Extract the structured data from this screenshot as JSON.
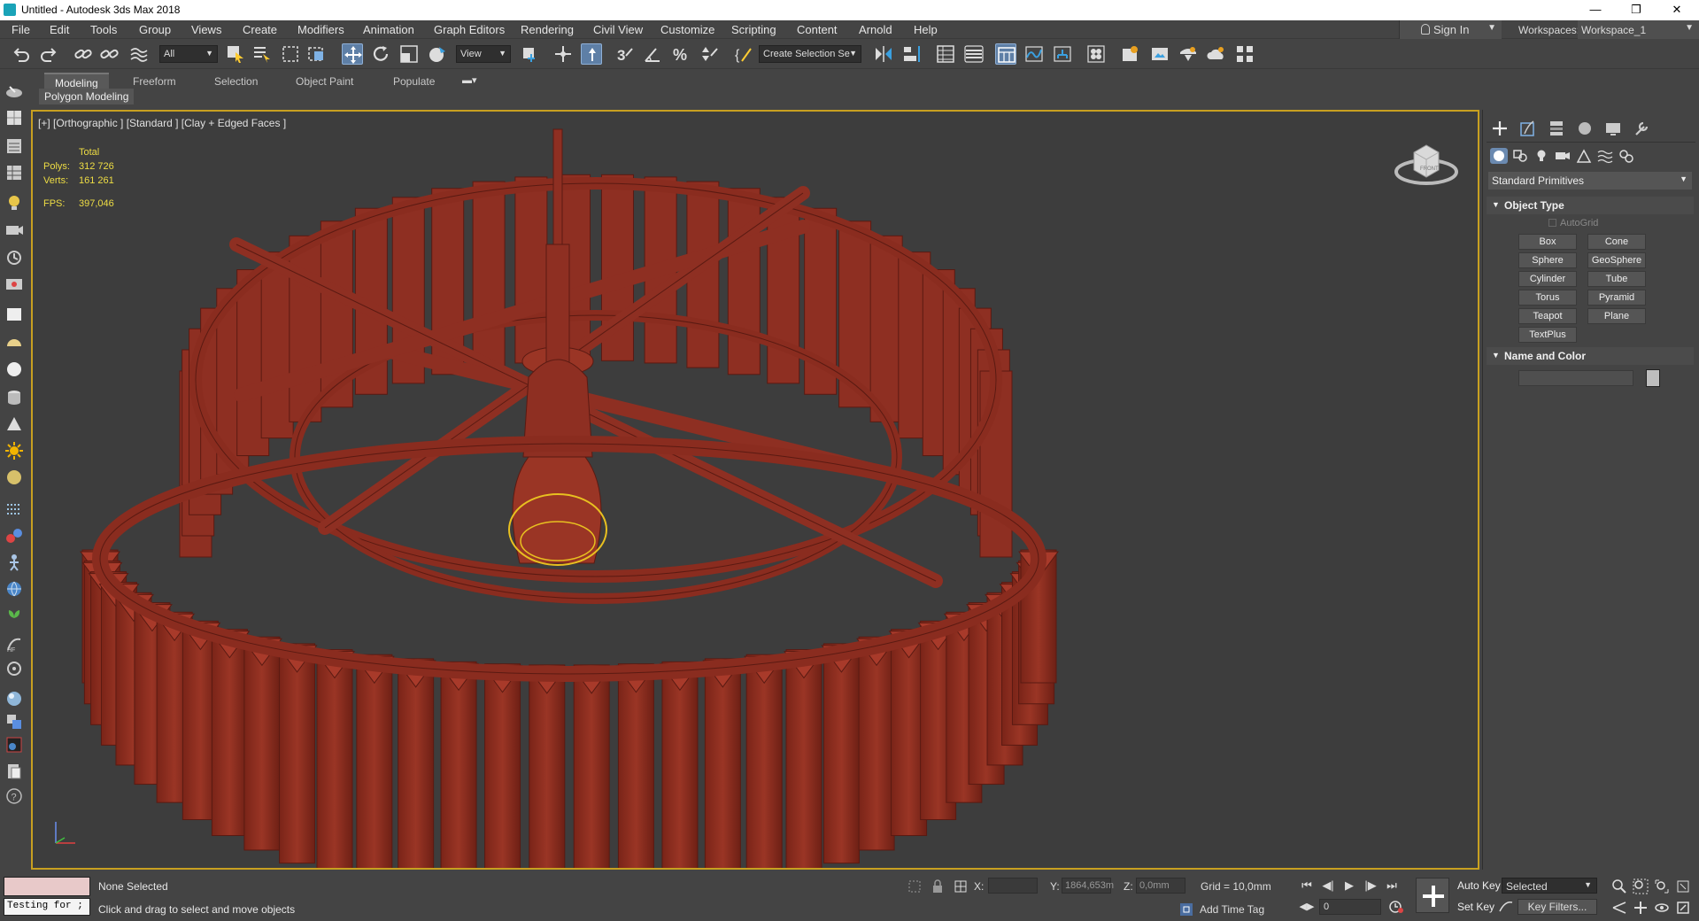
{
  "window": {
    "title": "Untitled - Autodesk 3ds Max 2018",
    "controls": {
      "minimize": "—",
      "restore": "❐",
      "close": "✕"
    }
  },
  "menu": [
    "File",
    "Edit",
    "Tools",
    "Group",
    "Views",
    "Create",
    "Modifiers",
    "Animation",
    "Graph Editors",
    "Rendering",
    "Civil View",
    "Customize",
    "Scripting",
    "Content",
    "Arnold",
    "Help"
  ],
  "account": {
    "sign_in": "Sign In",
    "workspaces_label": "Workspaces:",
    "workspace": "Workspace_1"
  },
  "toolbar": {
    "selection_filter": "All",
    "ref_coord": "View",
    "selection_set": "Create Selection Se"
  },
  "ribbon": {
    "tabs": [
      "Modeling",
      "Freeform",
      "Selection",
      "Object Paint",
      "Populate"
    ],
    "active_tab": "Modeling",
    "panel_label": "Polygon Modeling"
  },
  "viewport": {
    "label": "[+] [Orthographic ] [Standard ] [Clay + Edged Faces ]",
    "stats": {
      "header": "Total",
      "polys_label": "Polys:",
      "polys": "312 726",
      "verts_label": "Verts:",
      "verts": "161 261",
      "fps_label": "FPS:",
      "fps": "397,046"
    },
    "viewcube_face": "FRONT",
    "model_color": "#8e2f22",
    "wire_color": "#5a1a12",
    "selection_color": "#e8c020"
  },
  "command_panel": {
    "category": "Standard Primitives",
    "object_type": {
      "title": "Object Type",
      "autogrid": "AutoGrid",
      "buttons": [
        "Box",
        "Cone",
        "Sphere",
        "GeoSphere",
        "Cylinder",
        "Tube",
        "Torus",
        "Pyramid",
        "Teapot",
        "Plane",
        "TextPlus"
      ]
    },
    "name_and_color": {
      "title": "Name and Color"
    }
  },
  "status": {
    "maxscript_text": "Testing for ;",
    "line1": "None Selected",
    "line2": "Click and drag to select and move objects",
    "x_label": "X:",
    "y_label": "Y:",
    "y_value": "1864,653m",
    "z_label": "Z:",
    "z_value": "0,0mm",
    "grid": "Grid = 10,0mm",
    "add_time_tag": "Add Time Tag",
    "frame": "0",
    "auto_key": "Auto Key",
    "set_key": "Set Key",
    "selected": "Selected",
    "key_filters": "Key Filters..."
  }
}
